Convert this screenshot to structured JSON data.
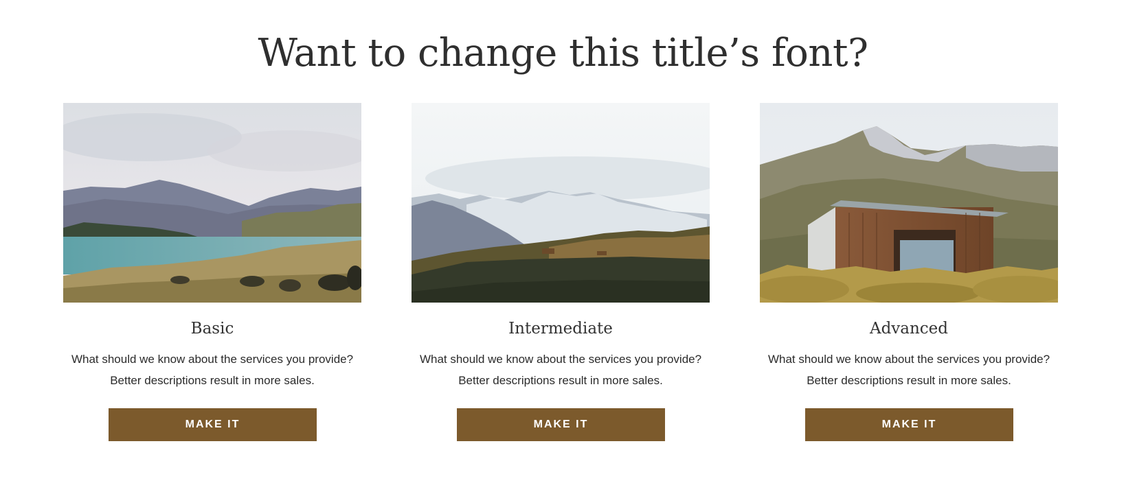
{
  "page": {
    "title": "Want to change this title’s font?"
  },
  "theme": {
    "button_color": "#7c5a2c",
    "button_text_color": "#ffffff"
  },
  "cards": [
    {
      "title": "Basic",
      "description_line1": "What should we know about the services you provide?",
      "description_line2": "Better descriptions result in more sales.",
      "button_label": "MAKE IT",
      "image": "lake-mountains-photo"
    },
    {
      "title": "Intermediate",
      "description_line1": "What should we know about the services you provide?",
      "description_line2": "Better descriptions result in more sales.",
      "button_label": "MAKE IT",
      "image": "snowy-mountains-photo"
    },
    {
      "title": "Advanced",
      "description_line1": "What should we know about the services you provide?",
      "description_line2": "Better descriptions result in more sales.",
      "button_label": "MAKE IT",
      "image": "mountain-cabin-photo"
    }
  ]
}
